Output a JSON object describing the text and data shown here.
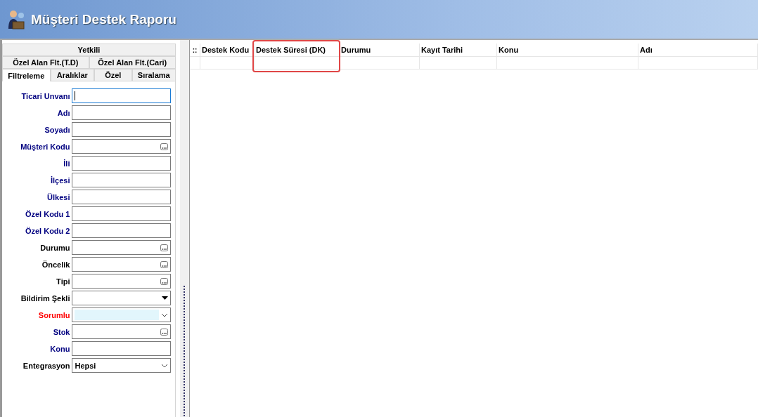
{
  "window": {
    "title": "Müşteri Destek Raporu"
  },
  "tab_rows": [
    [
      {
        "label": "Yetkili",
        "selected": false
      }
    ],
    [
      {
        "label": "Özel Alan Flt.(T.D)",
        "selected": false
      },
      {
        "label": "Özel Alan Flt.(Cari)",
        "selected": false
      }
    ],
    [
      {
        "label": "Filtreleme",
        "selected": true
      },
      {
        "label": "Aralıklar",
        "selected": false
      },
      {
        "label": "Özel",
        "selected": false
      },
      {
        "label": "Sıralama",
        "selected": false
      }
    ]
  ],
  "fields": [
    {
      "label": "Ticari Unvanı",
      "color": "#000080",
      "kind": "text",
      "focused": true
    },
    {
      "label": "Adı",
      "color": "#000080",
      "kind": "text"
    },
    {
      "label": "Soyadı",
      "color": "#000080",
      "kind": "text"
    },
    {
      "label": "Müşteri Kodu",
      "color": "#000080",
      "kind": "lookup"
    },
    {
      "label": "İli",
      "color": "#000080",
      "kind": "text"
    },
    {
      "label": "İlçesi",
      "color": "#000080",
      "kind": "text"
    },
    {
      "label": "Ülkesi",
      "color": "#000080",
      "kind": "text"
    },
    {
      "label": "Özel Kodu 1",
      "color": "#000080",
      "kind": "text"
    },
    {
      "label": "Özel Kodu 2",
      "color": "#000080",
      "kind": "text"
    },
    {
      "label": "Durumu",
      "color": "#000000",
      "kind": "lookup"
    },
    {
      "label": "Öncelik",
      "color": "#000000",
      "kind": "lookup"
    },
    {
      "label": "Tipi",
      "color": "#000000",
      "kind": "lookup"
    },
    {
      "label": "Bildirim Şekli",
      "color": "#000000",
      "kind": "dropdown"
    },
    {
      "label": "Sorumlu",
      "color": "#ff0000",
      "kind": "combo",
      "highlighted": true
    },
    {
      "label": "Stok",
      "color": "#000080",
      "kind": "lookup"
    },
    {
      "label": "Konu",
      "color": "#000080",
      "kind": "text"
    },
    {
      "label": "Entegrasyon",
      "color": "#000000",
      "kind": "combo",
      "value": "Hepsi"
    }
  ],
  "table": {
    "indicator": "::",
    "columns": [
      {
        "label": "Destek Kodu",
        "highlighted": false
      },
      {
        "label": "Destek Süresi (DK)",
        "highlighted": true
      },
      {
        "label": "Durumu",
        "highlighted": false
      },
      {
        "label": "Kayıt Tarihi",
        "highlighted": false
      },
      {
        "label": "Konu",
        "highlighted": false
      },
      {
        "label": "Adı",
        "highlighted": false
      }
    ]
  }
}
